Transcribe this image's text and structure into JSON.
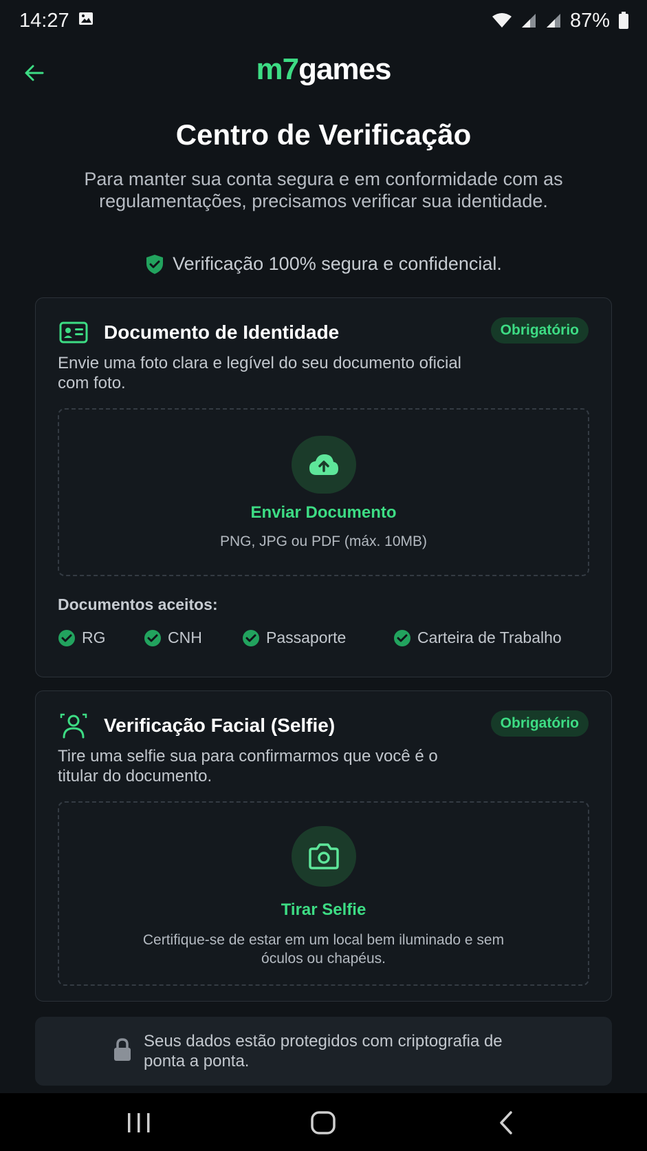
{
  "status_bar": {
    "time": "14:27",
    "battery": "87%"
  },
  "header": {
    "logo_part1": "m7",
    "logo_part2": "games"
  },
  "page": {
    "title": "Centro de Verificação",
    "subtitle": "Para manter sua conta segura e em conformidade com as regulamentações, precisamos verificar sua identidade.",
    "secure_note": "Verificação 100% segura e confidencial."
  },
  "identity_card": {
    "title": "Documento de Identidade",
    "badge": "Obrigatório",
    "description": "Envie uma foto clara e legível do seu documento oficial com foto.",
    "upload_label": "Enviar Documento",
    "upload_hint": "PNG, JPG ou PDF (máx. 10MB)",
    "accepted_label": "Documentos aceitos:",
    "accepted": [
      "RG",
      "CNH",
      "Passaporte",
      "Carteira de Trabalho"
    ]
  },
  "selfie_card": {
    "title": "Verificação Facial (Selfie)",
    "badge": "Obrigatório",
    "description": "Tire uma selfie sua para confirmarmos que você é o titular do documento.",
    "capture_label": "Tirar Selfie",
    "capture_hint": "Certifique-se de estar em um local bem iluminado e sem óculos ou chapéus."
  },
  "privacy": {
    "text": "Seus dados estão protegidos com criptografia de ponta a ponta."
  },
  "icons": {
    "back": "arrow-left-icon",
    "shield": "shield-check-icon",
    "id_card": "id-card-icon",
    "upload": "cloud-upload-icon",
    "check": "check-circle-icon",
    "face": "face-scan-icon",
    "camera": "camera-icon",
    "lock": "lock-icon"
  },
  "colors": {
    "accent": "#3ddc84",
    "background": "#101418",
    "card": "#14191e",
    "badge_bg": "#163a28"
  }
}
